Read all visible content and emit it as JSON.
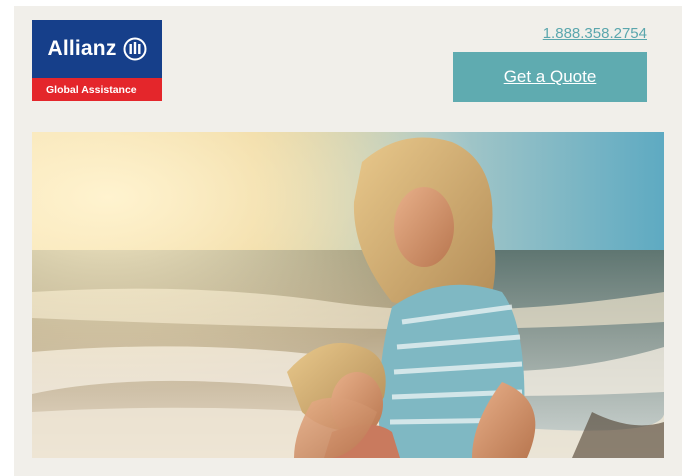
{
  "brand": {
    "name": "Allianz",
    "tagline": "Global Assistance",
    "primary_color": "#163f8a",
    "accent_color": "#e4262b",
    "icon": "allianz-eagle-icon"
  },
  "header": {
    "phone": "1.888.358.2754",
    "cta_label": "Get a Quote",
    "cta_color": "#5fabb0"
  },
  "hero": {
    "image_subject": "mother-hugging-daughter-on-beach-photo"
  }
}
